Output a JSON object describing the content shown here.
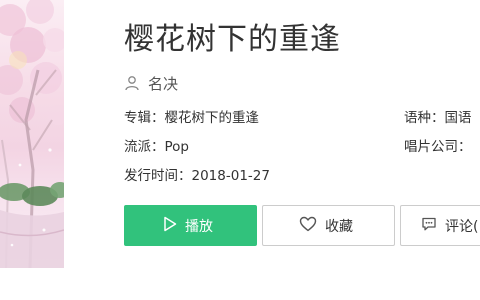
{
  "song": {
    "title": "樱花树下的重逢",
    "artist": "名决"
  },
  "details": {
    "album_label": "专辑：",
    "album_value": "樱花树下的重逢",
    "genre_label": "流派：",
    "genre_value": "Pop",
    "release_label": "发行时间：",
    "release_value": "2018-01-27",
    "language_label": "语种：",
    "language_value": "国语",
    "record_label": "唱片公司："
  },
  "actions": {
    "play_label": "播放",
    "favorite_label": "收藏",
    "comment_label": "评论("
  },
  "colors": {
    "accent": "#31c27c",
    "text": "#333333",
    "border": "#cccccc"
  },
  "icons": {
    "artist": "person-icon",
    "play": "play-icon",
    "favorite": "heart-icon",
    "comment": "comment-icon"
  }
}
